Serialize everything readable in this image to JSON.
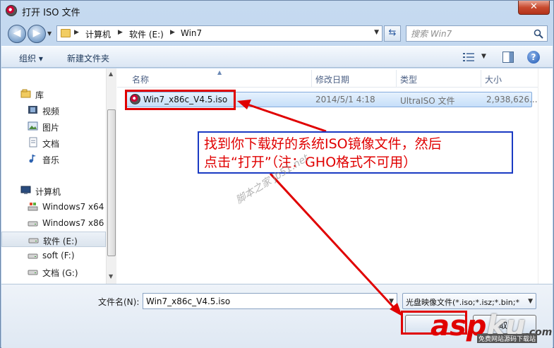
{
  "window": {
    "title": "打开 ISO 文件",
    "close_label": "✕"
  },
  "address": {
    "crumbs": [
      "计算机",
      "软件 (E:)",
      "Win7"
    ],
    "search_placeholder": "搜索 Win7"
  },
  "toolbar": {
    "organize_label": "组织 ▾",
    "new_folder_label": "新建文件夹",
    "help_label": "?"
  },
  "nav": {
    "items": [
      {
        "label": "库",
        "icon": "library-icon"
      },
      {
        "label": "视频",
        "icon": "video-icon"
      },
      {
        "label": "图片",
        "icon": "picture-icon"
      },
      {
        "label": "文档",
        "icon": "document-icon"
      },
      {
        "label": "音乐",
        "icon": "music-icon"
      },
      {
        "label": "计算机",
        "icon": "computer-icon"
      },
      {
        "label": "Windows7 x64",
        "icon": "drive-icon"
      },
      {
        "label": "Windows7 x86",
        "icon": "drive-icon"
      },
      {
        "label": "软件 (E:)",
        "icon": "drive-icon",
        "selected": true
      },
      {
        "label": "soft (F:)",
        "icon": "drive-icon"
      },
      {
        "label": "文档 (G:)",
        "icon": "drive-icon"
      }
    ]
  },
  "columns": [
    "名称",
    "修改日期",
    "类型",
    "大小"
  ],
  "files": [
    {
      "name": "Win7_x86c_V4.5.iso",
      "date": "2014/5/1 4:18",
      "type": "UltraISO 文件",
      "size": "2,938,626..."
    }
  ],
  "bottom": {
    "filename_label": "文件名(N):",
    "filename_value": "Win7_x86c_V4.5.iso",
    "filter_value": "光盘映像文件(*.iso;*.isz;*.bin;*",
    "open_label": "",
    "cancel_label": "取"
  },
  "annotation": {
    "line1": "找到你下载好的系统ISO镜像文件，然后",
    "line2": "点击“打开”（注：GHO格式不可用）",
    "watermark": "脚本之家 jb51.net",
    "logo_asp": "asp",
    "logo_ku": "ku",
    "logo_com": ".com",
    "logo_sub": "免费网站源码下载站"
  },
  "colors": {
    "annotation_red": "#e00000",
    "annotation_blue": "#1a3ac3",
    "selection_blue": "#c6dff9"
  }
}
